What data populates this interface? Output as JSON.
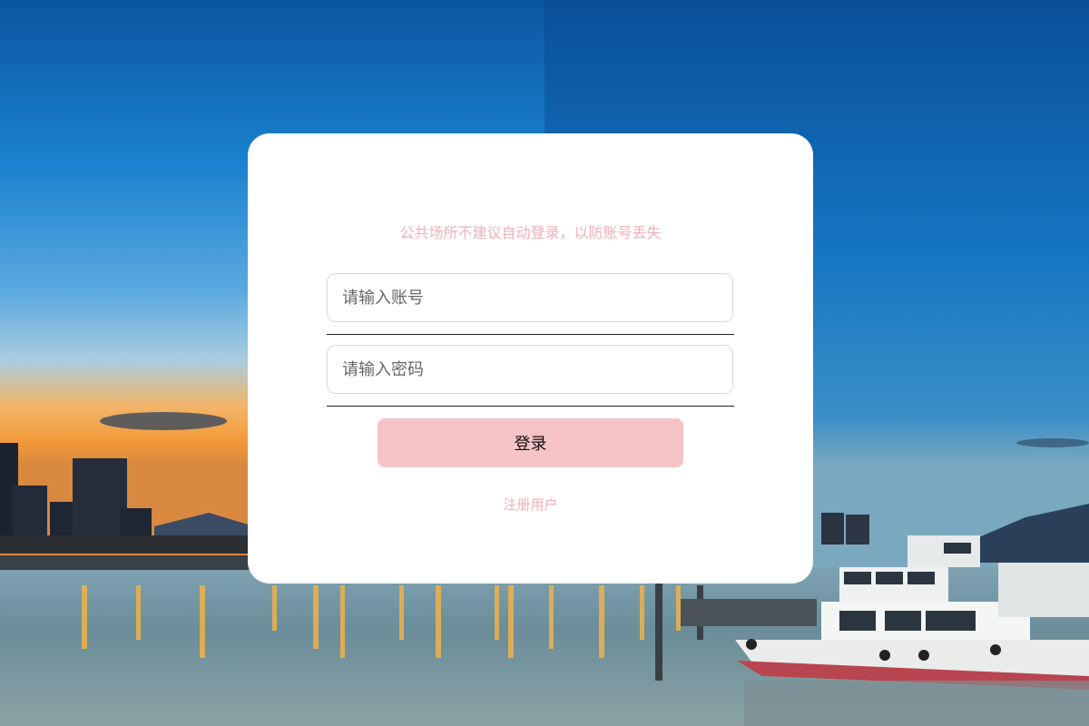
{
  "background": {
    "sky_top": "#0a5aa5",
    "sky_mid": "#1f8ed6",
    "sunset": "#f7a83a",
    "water": "#6a8fa0"
  },
  "login": {
    "tip": "公共场所不建议自动登录，以防账号丢失",
    "username_placeholder": "请输入账号",
    "password_placeholder": "请输入密码",
    "username_value": "",
    "password_value": "",
    "login_label": "登录",
    "register_label": "注册用户",
    "accent": "#f6c3c6",
    "tip_color": "#f4aeb6"
  }
}
